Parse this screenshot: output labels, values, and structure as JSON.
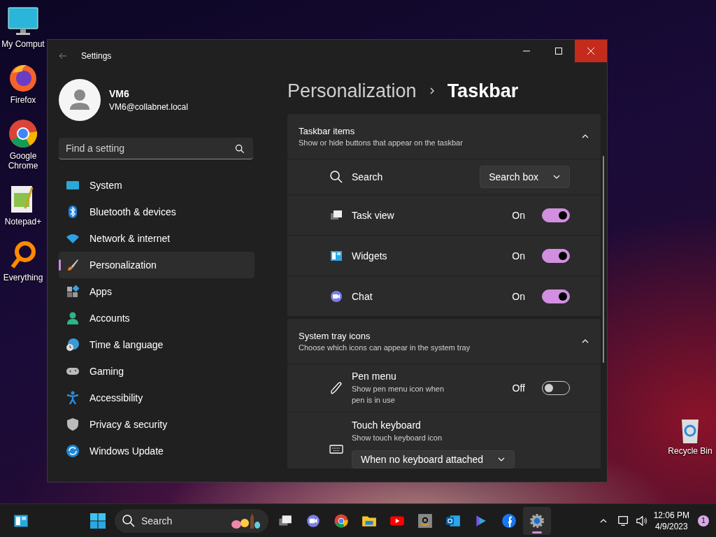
{
  "desktop_icons": [
    {
      "label": "My Comput"
    },
    {
      "label": "Firefox"
    },
    {
      "label": "Google Chrome"
    },
    {
      "label": "Notepad+"
    },
    {
      "label": "Everything"
    }
  ],
  "recycle_bin": {
    "label": "Recycle Bin"
  },
  "window": {
    "title": "Settings",
    "user": {
      "name": "VM6",
      "email": "VM6@collabnet.local"
    },
    "search": {
      "placeholder": "Find a setting"
    },
    "nav": [
      {
        "label": "System",
        "selected": false
      },
      {
        "label": "Bluetooth & devices",
        "selected": false
      },
      {
        "label": "Network & internet",
        "selected": false
      },
      {
        "label": "Personalization",
        "selected": true
      },
      {
        "label": "Apps",
        "selected": false
      },
      {
        "label": "Accounts",
        "selected": false
      },
      {
        "label": "Time & language",
        "selected": false
      },
      {
        "label": "Gaming",
        "selected": false
      },
      {
        "label": "Accessibility",
        "selected": false
      },
      {
        "label": "Privacy & security",
        "selected": false
      },
      {
        "label": "Windows Update",
        "selected": false
      }
    ],
    "breadcrumb": [
      "Personalization",
      "Taskbar"
    ],
    "sections": [
      {
        "title": "Taskbar items",
        "subtitle": "Show or hide buttons that appear on the taskbar",
        "expanded": true,
        "rows": [
          {
            "kind": "dropdown",
            "label": "Search",
            "value": "Search box"
          },
          {
            "kind": "toggle",
            "label": "Task view",
            "state": "On",
            "on": true
          },
          {
            "kind": "toggle",
            "label": "Widgets",
            "state": "On",
            "on": true
          },
          {
            "kind": "toggle",
            "label": "Chat",
            "state": "On",
            "on": true
          }
        ]
      },
      {
        "title": "System tray icons",
        "subtitle": "Choose which icons can appear in the system tray",
        "expanded": true,
        "rows": [
          {
            "kind": "toggle",
            "label": "Pen menu",
            "description": "Show pen menu icon when pen is in use",
            "state": "Off",
            "on": false
          },
          {
            "kind": "dropdown-below",
            "label": "Touch keyboard",
            "description": "Show touch keyboard icon",
            "value": "When no keyboard attached"
          }
        ]
      }
    ]
  },
  "taskbar": {
    "search": {
      "placeholder": "Search"
    },
    "apps": [
      {
        "selected": false
      },
      {
        "selected": false
      },
      {
        "selected": false
      },
      {
        "selected": false
      },
      {
        "selected": false
      },
      {
        "selected": false
      },
      {
        "selected": false
      },
      {
        "selected": false
      },
      {
        "selected": false
      },
      {
        "selected": true
      }
    ],
    "clock": {
      "time": "12:06 PM",
      "date": "4/9/2023"
    },
    "notifications": "1"
  }
}
